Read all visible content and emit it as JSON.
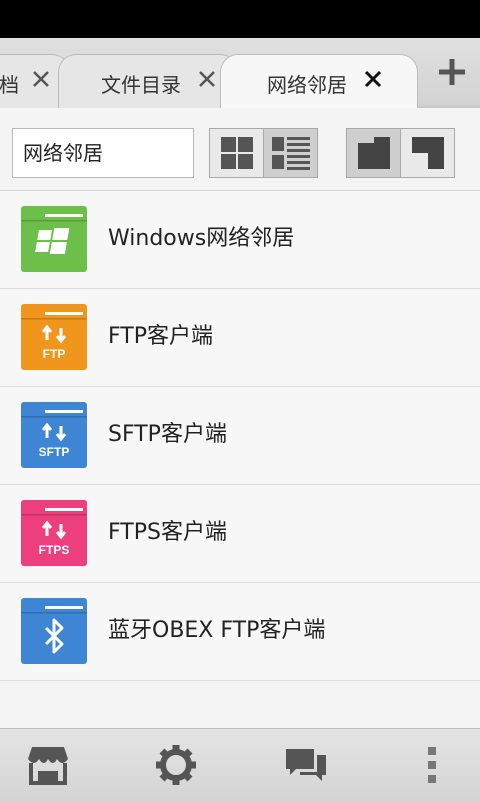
{
  "tabs": [
    {
      "label": "档",
      "active": false
    },
    {
      "label": "文件目录",
      "active": false
    },
    {
      "label": "网络邻居",
      "active": true
    }
  ],
  "location": {
    "text": "网络邻居"
  },
  "items": [
    {
      "name": "Windows网络邻居",
      "icon": "windows-folder-icon",
      "color": "#6cc04a",
      "badge": ""
    },
    {
      "name": "FTP客户端",
      "icon": "ftp-folder-icon",
      "color": "#f0961d",
      "badge": "FTP"
    },
    {
      "name": "SFTP客户端",
      "icon": "sftp-folder-icon",
      "color": "#3e86d4",
      "badge": "SFTP"
    },
    {
      "name": "FTPS客户端",
      "icon": "ftps-folder-icon",
      "color": "#ec3f7c",
      "badge": "FTPS"
    },
    {
      "name": "蓝牙OBEX FTP客户端",
      "icon": "bluetooth-folder-icon",
      "color": "#3e86d4",
      "badge": ""
    }
  ],
  "colors": {
    "accent": "#555555"
  }
}
